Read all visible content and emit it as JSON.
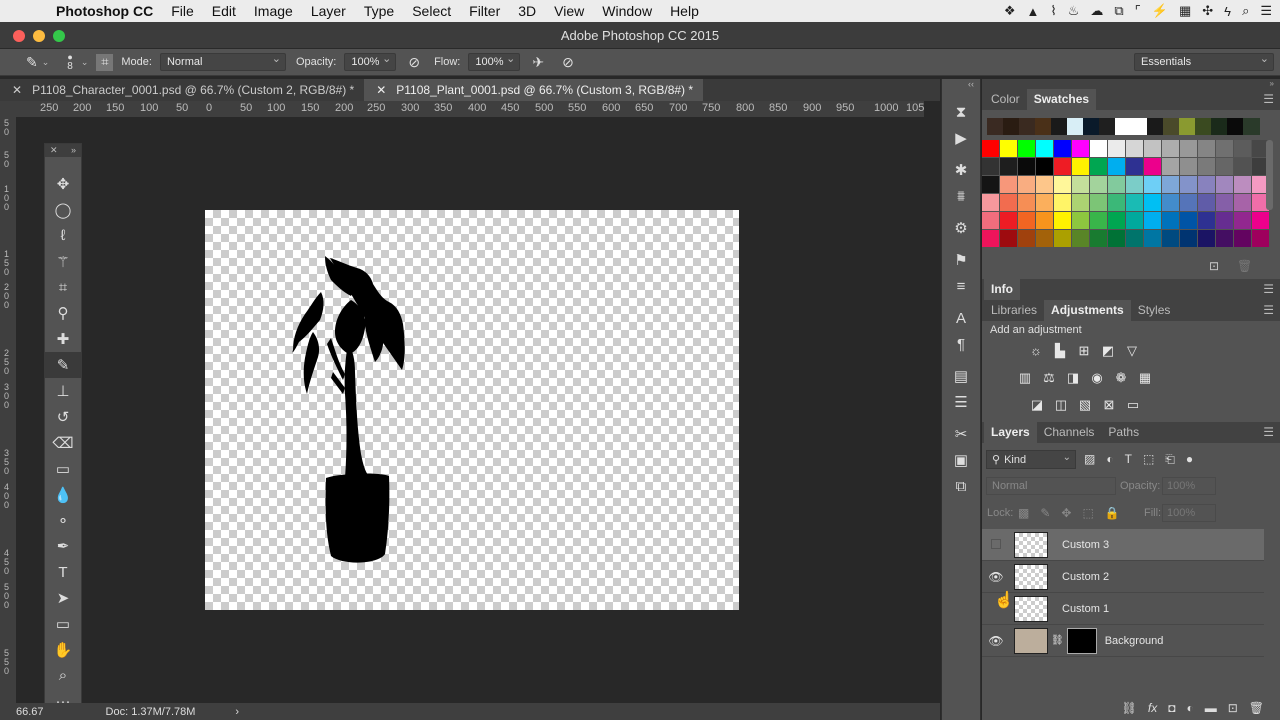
{
  "menubar": {
    "app": "Photoshop CC",
    "items": [
      "File",
      "Edit",
      "Image",
      "Layer",
      "Type",
      "Select",
      "Filter",
      "3D",
      "View",
      "Window",
      "Help"
    ]
  },
  "window": {
    "title": "Adobe Photoshop CC 2015"
  },
  "options": {
    "brush_size": "8",
    "mode_label": "Mode:",
    "mode_value": "Normal",
    "opacity_label": "Opacity:",
    "opacity_value": "100%",
    "flow_label": "Flow:",
    "flow_value": "100%",
    "workspace": "Essentials"
  },
  "doc_tabs": [
    {
      "label": "P1108_Character_0001.psd @ 66.7% (Custom 2, RGB/8#) *"
    },
    {
      "label": "P1108_Plant_0001.psd @ 66.7% (Custom 3, RGB/8#) *"
    }
  ],
  "ruler_h": [
    "250",
    "200",
    "150",
    "100",
    "50",
    "0",
    "50",
    "100",
    "150",
    "200",
    "250",
    "300",
    "350",
    "400",
    "450",
    "500",
    "550",
    "600",
    "650",
    "700",
    "750",
    "800",
    "850",
    "900",
    "950",
    "1000",
    "105"
  ],
  "ruler_v": [
    "5",
    "0",
    "5",
    "0",
    "1",
    "0",
    "0",
    "1",
    "5",
    "0",
    "2",
    "0",
    "0",
    "2",
    "5",
    "0",
    "3",
    "0",
    "0",
    "3",
    "5",
    "0",
    "4",
    "0",
    "0",
    "4",
    "5",
    "0",
    "5",
    "0",
    "0",
    "5",
    "5",
    "0"
  ],
  "status": {
    "zoom": "66.67",
    "doc": "Doc: 1.37M/7.78M"
  },
  "color_panel": {
    "tabs": [
      "Color",
      "Swatches"
    ],
    "active": "Swatches"
  },
  "info_panel": {
    "label": "Info"
  },
  "adjust_panel": {
    "tabs": [
      "Libraries",
      "Adjustments",
      "Styles"
    ],
    "active": "Adjustments",
    "heading": "Add an adjustment"
  },
  "layers_panel": {
    "tabs": [
      "Layers",
      "Channels",
      "Paths"
    ],
    "active": "Layers",
    "kind_filter": "Kind",
    "blend_mode": "Normal",
    "opacity_label": "Opacity:",
    "opacity_value": "100%",
    "lock_label": "Lock:",
    "fill_label": "Fill:",
    "fill_value": "100%",
    "layers": [
      {
        "name": "Custom 3",
        "visible": false,
        "selected": true
      },
      {
        "name": "Custom 2",
        "visible": true,
        "selected": false
      },
      {
        "name": "Custom 1",
        "visible": false,
        "selected": false
      },
      {
        "name": "Background",
        "visible": true,
        "selected": false
      }
    ]
  },
  "colors": {
    "swatch_row0": [
      "#3a2a22",
      "#2a1c12",
      "#3a2a20",
      "#4a3018",
      "#1a1a1a",
      "#d8eef6",
      "#0a1a2a",
      "#1f1f1f",
      "#fff",
      "#fff",
      "#1a1a1a",
      "#4a4a2a",
      "#8a9a30",
      "#3a4a20",
      "#1a2a1a",
      "#0a0a0a",
      "#2a3a2a"
    ],
    "swatch_rows": [
      [
        "#ff0000",
        "#ffff00",
        "#00ff00",
        "#00ffff",
        "#0000ff",
        "#ff00ff",
        "#ffffff",
        "#ebebeb",
        "#d6d6d6",
        "#c2c2c2",
        "#adadad",
        "#999999",
        "#858585",
        "#707070",
        "#5c5c5c",
        "#474747"
      ],
      [
        "#333333",
        "#1e1e1e",
        "#0a0a0a",
        "#000000",
        "#ee1c24",
        "#fff200",
        "#00a651",
        "#00aeef",
        "#2e3192",
        "#ec008c",
        "#a4a4a4",
        "#8f8f8f",
        "#7a7a7a",
        "#666666",
        "#525252",
        "#3d3d3d"
      ],
      [
        "#141414",
        "#f7977a",
        "#f9ad81",
        "#fdc68a",
        "#fff79a",
        "#c4df9b",
        "#a3d39c",
        "#82ca9d",
        "#7bcdc8",
        "#6ecff6",
        "#7ea7d8",
        "#8393ca",
        "#8882be",
        "#a187be",
        "#bc8dbf",
        "#f49ac2"
      ],
      [
        "#f6989d",
        "#f26c4f",
        "#f68e55",
        "#fbaf5c",
        "#fff467",
        "#acd372",
        "#7cc576",
        "#3bb878",
        "#1abbb4",
        "#00bff3",
        "#438ccb",
        "#5574b9",
        "#605ca8",
        "#855fa8",
        "#a763a8",
        "#f06ea9"
      ],
      [
        "#f26d7d",
        "#ed1c24",
        "#f26522",
        "#f7941d",
        "#fff200",
        "#8dc63f",
        "#39b54a",
        "#00a651",
        "#00a99d",
        "#00aeef",
        "#0072bc",
        "#0054a6",
        "#2e3192",
        "#662d91",
        "#92278f",
        "#ec008c"
      ],
      [
        "#ed145b",
        "#9e0b0f",
        "#a0410d",
        "#a3620a",
        "#aba000",
        "#598527",
        "#197b30",
        "#007236",
        "#00746b",
        "#0076a3",
        "#004a80",
        "#003471",
        "#1b1464",
        "#440e62",
        "#630460",
        "#9e005d"
      ]
    ]
  }
}
